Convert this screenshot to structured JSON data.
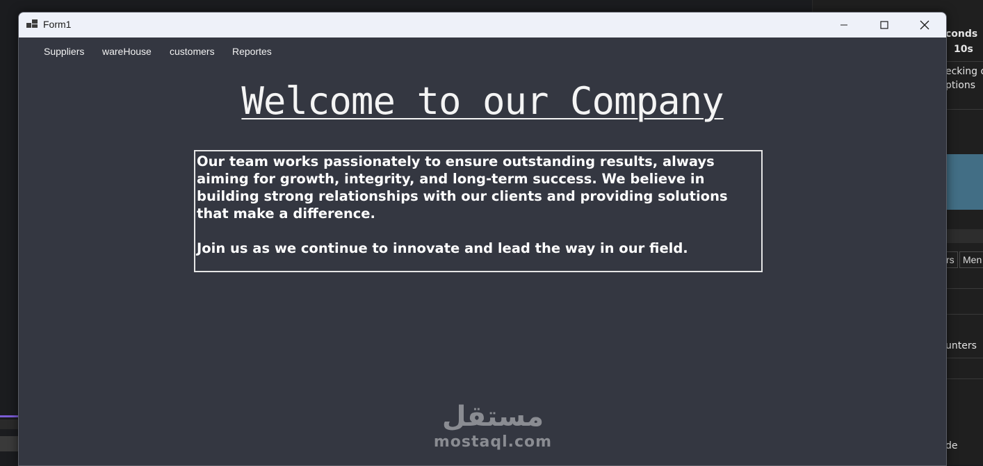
{
  "background": {
    "fragments": {
      "seconds": "conds",
      "time_10s": "10s",
      "checking": "ecking o",
      "options": "ptions",
      "tab_a": "rs",
      "tab_b": "Men",
      "counters": "unters",
      "mode": "de"
    }
  },
  "window": {
    "title": "Form1",
    "icon": "form-window-icon",
    "controls": {
      "minimize": "minimize-icon",
      "maximize": "maximize-icon",
      "close": "close-icon"
    }
  },
  "menu": {
    "items": [
      {
        "label": "Suppliers"
      },
      {
        "label": "wareHouse"
      },
      {
        "label": "customers"
      },
      {
        "label": "Reportes"
      }
    ]
  },
  "main": {
    "heading": "Welcome to our Company",
    "paragraph1": "Our team works passionately to ensure outstanding results, always aiming for growth, integrity, and long-term success. We believe in building strong relationships with our clients and providing solutions that make a difference.",
    "paragraph2": "Join us as we continue to innovate and lead the way in our field."
  },
  "watermark": {
    "arabic": "مستقل",
    "latin": "mostaql.com"
  },
  "colors": {
    "form_background": "#343741",
    "titlebar": "#eef1f9",
    "text": "#ffffff"
  }
}
